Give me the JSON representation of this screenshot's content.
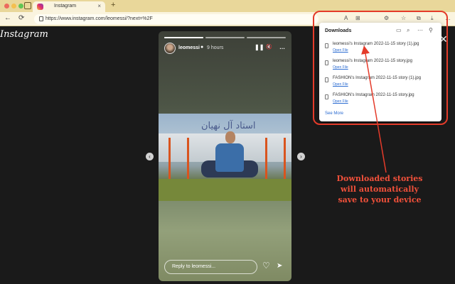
{
  "browser": {
    "tab_title": "Instagram",
    "tab_close": "×",
    "new_tab": "+",
    "url": "https://www.instagram.com/leomessi/?next=%2F",
    "nav": {
      "back": "←",
      "refresh": "⟳"
    },
    "toolbar_icons": {
      "read_aloud": "A",
      "immersive": "⊞",
      "extensions": "⚙",
      "favorites": "☆",
      "collections": "⧉",
      "downloads": "⤓",
      "more": "…"
    }
  },
  "instagram": {
    "logo": "Instagram",
    "close": "✕",
    "prev": "‹",
    "next": "›",
    "story": {
      "username": "leomessi",
      "verified": "●",
      "time": "9 hours",
      "pause": "❚❚",
      "mute": "🔇",
      "more": "…",
      "progress": [
        1.0,
        0.0,
        0.0
      ],
      "photo_sign": "استاد آل نهيان",
      "reply_placeholder": "Reply to leomessi...",
      "like": "♡",
      "share": "➤"
    }
  },
  "downloads": {
    "title": "Downloads",
    "header_icons": {
      "folder": "▭",
      "search": "⌕",
      "more": "⋯",
      "pin": "⚲"
    },
    "items": [
      {
        "name": "leomessi's Instagram 2022-11-15 story (1).jpg",
        "action": "Open File"
      },
      {
        "name": "leomessi's Instagram 2022-11-15 story.jpg",
        "action": "Open File"
      },
      {
        "name": "FASHION's Instagram 2022-11-15 story (1).jpg",
        "action": "Open File"
      },
      {
        "name": "FASHION's Instagram 2022-11-15 story.jpg",
        "action": "Open File"
      }
    ],
    "see_more": "See More"
  },
  "annotation": {
    "lines": [
      "Downloaded stories",
      "will automatically",
      "save to your device"
    ],
    "color": "#f0503a"
  }
}
